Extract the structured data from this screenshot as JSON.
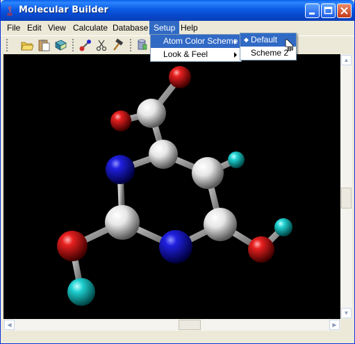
{
  "window": {
    "title": "Molecular Builder"
  },
  "menubar": {
    "items": [
      {
        "label": "File"
      },
      {
        "label": "Edit"
      },
      {
        "label": "View"
      },
      {
        "label": "Calculate"
      },
      {
        "label": "Database"
      },
      {
        "label": "Setup"
      },
      {
        "label": "Help"
      }
    ]
  },
  "setup_menu": {
    "items": [
      {
        "label": "Atom Color Scheme"
      },
      {
        "label": "Look & Feel"
      }
    ]
  },
  "color_scheme_submenu": {
    "items": [
      {
        "label": "Default",
        "marker": "◆"
      },
      {
        "label": "Scheme 2",
        "marker": ""
      }
    ]
  },
  "toolbar": {
    "icons": [
      "open-folder-icon",
      "clipboard-icon",
      "book-icon",
      "bond-tool-icon",
      "scissors-icon",
      "hammer-icon",
      "database-icon"
    ]
  },
  "colors": {
    "oxygen": "#e00000",
    "nitrogen": "#1c1cf0",
    "carbon": "#f0f0f0",
    "hydrogen": "#22d0d0",
    "bond": "#9c9c9c",
    "highlight": "#316ac5"
  }
}
